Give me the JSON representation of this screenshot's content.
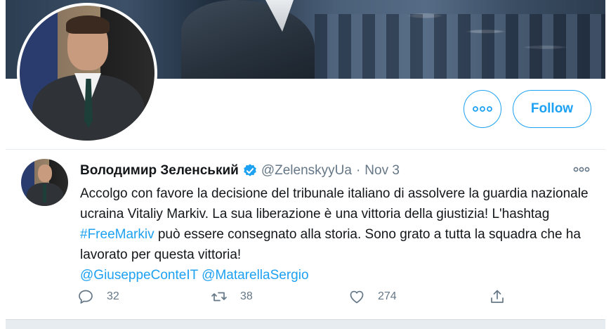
{
  "profile": {
    "more_label": "More",
    "follow_label": "Follow"
  },
  "tweet": {
    "author_name": "Володимир Зеленський",
    "handle": "@ZelenskyyUa",
    "separator": "·",
    "date": "Nov 3",
    "text_part1": "Accolgo con favore la decisione del tribunale italiano di assolvere la guardia nazionale ucraina Vitaliy Markiv. La sua liberazione è una vittoria della giustizia! L'hashtag ",
    "hashtag": "#FreeMarkiv",
    "text_part2": " può essere consegnato alla storia. Sono grato a tutta la squadra che ha lavorato per questa vittoria!",
    "mention1": "@GiuseppeConteIT",
    "mention2": "@MatarellaSergio",
    "replies": "32",
    "retweets": "38",
    "likes": "274"
  },
  "icons": {
    "more": "more-dots-icon",
    "verified": "verified-badge-icon",
    "reply": "reply-bubble-icon",
    "retweet": "retweet-icon",
    "like": "heart-icon",
    "share": "share-icon"
  },
  "colors": {
    "accent": "#1da1f2",
    "muted": "#657786",
    "text": "#14171a"
  }
}
